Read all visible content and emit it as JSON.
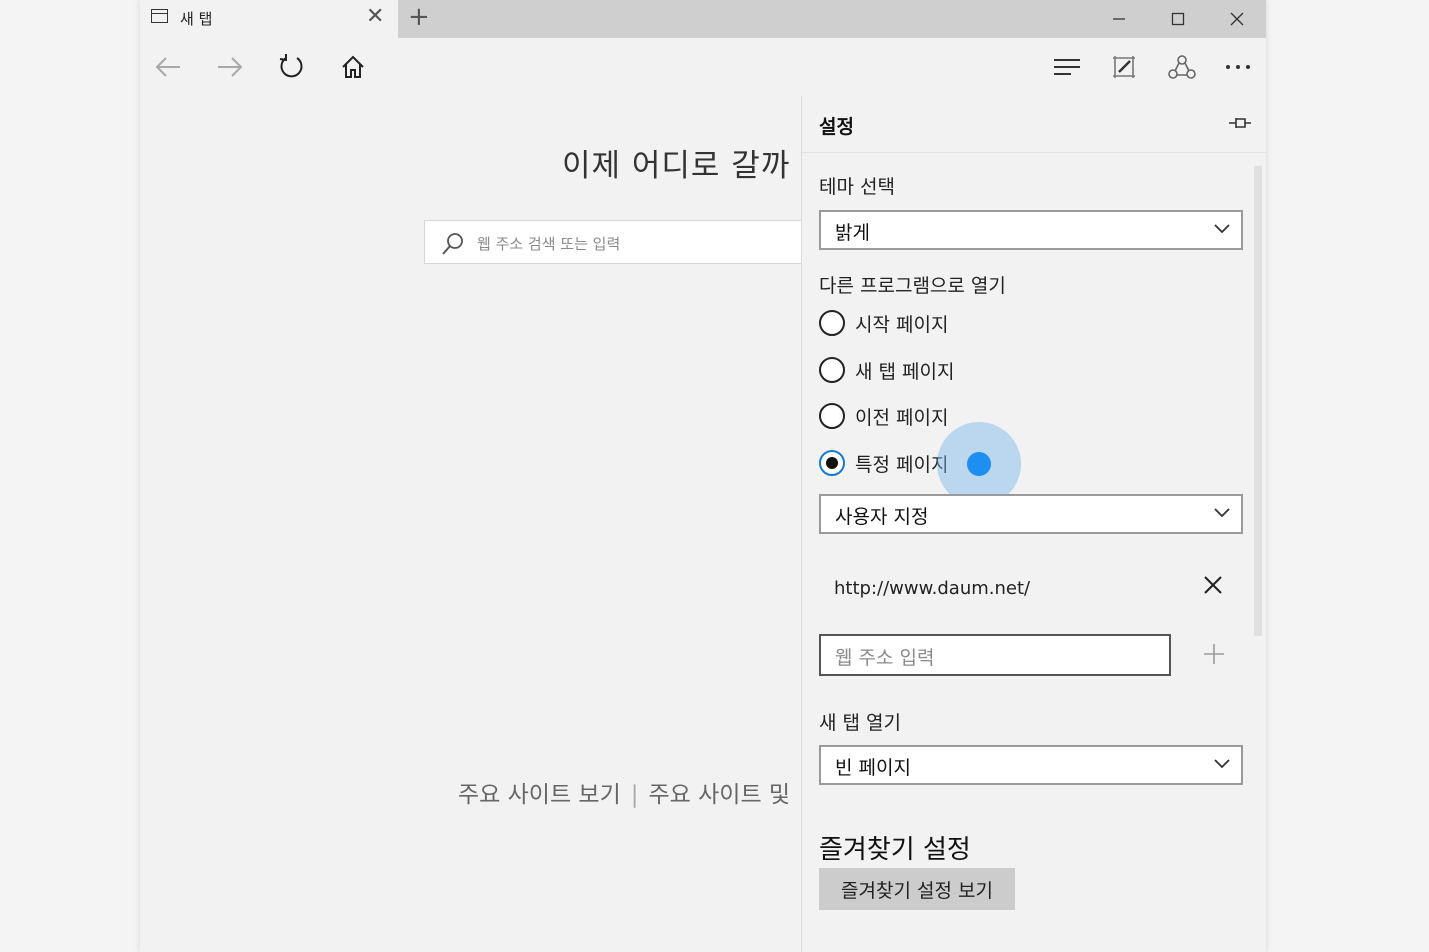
{
  "tabbar": {
    "tab_title": "새 탭",
    "tab_close": "✕",
    "new_tab": "+"
  },
  "new_tab_page": {
    "heading": "이제 어디로 갈까",
    "search_placeholder": "웹 주소 검색 또는 입력",
    "link_top_sites": "주요 사이트 보기",
    "separator": "|",
    "link_top_sites_news": "주요 사이트 및"
  },
  "settings": {
    "title": "설정",
    "theme_label": "테마 선택",
    "theme_value": "밝게",
    "open_with_label": "다른 프로그램으로 열기",
    "radio_options": [
      {
        "label": "시작 페이지",
        "checked": false
      },
      {
        "label": "새 탭 페이지",
        "checked": false
      },
      {
        "label": "이전 페이지",
        "checked": false
      },
      {
        "label": "특정 페이지",
        "checked": true
      }
    ],
    "specific_page_value": "사용자 지정",
    "url_entry": "http://www.daum.net/",
    "url_input_placeholder": "웹 주소 입력",
    "new_tab_label": "새 탭 열기",
    "new_tab_value": "빈 페이지",
    "favorites_heading": "즐겨찾기 설정",
    "favorites_button": "즐겨찾기 설정 보기"
  },
  "icons": [
    "tab-page-icon",
    "back-arrow-icon",
    "forward-arrow-icon",
    "refresh-icon",
    "home-icon",
    "hub-icon",
    "web-note-icon",
    "share-icon",
    "more-icon",
    "pin-icon",
    "chevron-down-icon",
    "search-icon",
    "close-icon",
    "add-icon"
  ],
  "colors": {
    "accent": "#1478d4",
    "touch_indicator": "#1f8ef1"
  }
}
